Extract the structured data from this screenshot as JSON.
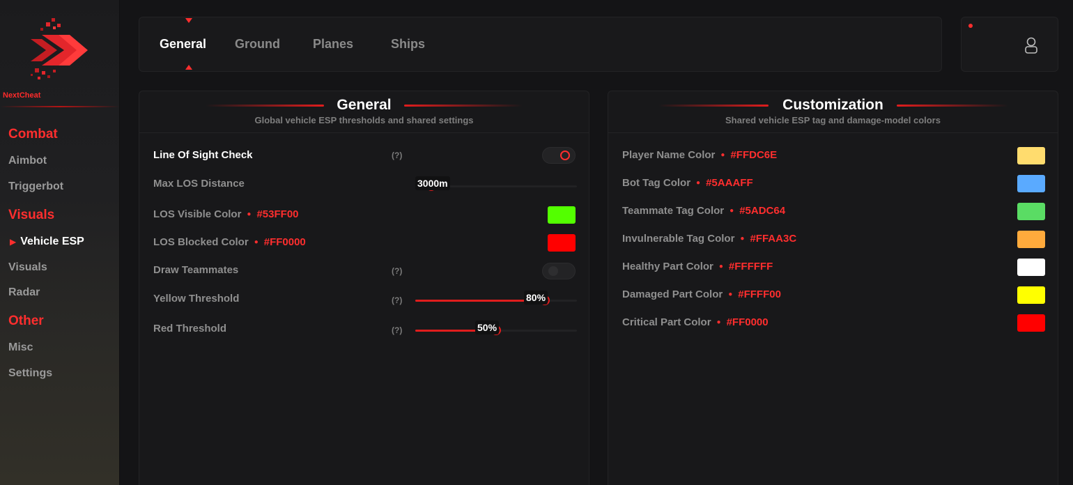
{
  "app": {
    "brand": "NextCheat"
  },
  "sidebar": {
    "sections": [
      {
        "label": "Combat",
        "items": [
          "Aimbot",
          "Triggerbot"
        ]
      },
      {
        "label": "Visuals",
        "items": [
          "Vehicle ESP",
          "Visuals",
          "Radar"
        ]
      },
      {
        "label": "Other",
        "items": [
          "Misc",
          "Settings"
        ]
      }
    ],
    "active_item": "Vehicle ESP"
  },
  "tabs": [
    {
      "label": "General",
      "active": true
    },
    {
      "label": "Ground",
      "active": false
    },
    {
      "label": "Planes",
      "active": false
    },
    {
      "label": "Ships",
      "active": false
    }
  ],
  "general_panel": {
    "title": "General",
    "subtitle": "Global vehicle ESP thresholds and shared settings",
    "line_of_sight": {
      "label": "Line Of Sight Check",
      "help": "(?)",
      "enabled": true
    },
    "max_los_distance": {
      "label": "Max LOS Distance",
      "value": "3000m",
      "fill": 0.1
    },
    "los_visible_color": {
      "label": "LOS Visible Color",
      "hex": "#53FF00",
      "color": "#53ff00"
    },
    "los_blocked_color": {
      "label": "LOS Blocked Color",
      "hex": "#FF0000",
      "color": "#ff0000"
    },
    "draw_teammates": {
      "label": "Draw Teammates",
      "help": "(?)",
      "enabled": false
    },
    "yellow_threshold": {
      "label": "Yellow Threshold",
      "help": "(?)",
      "value": "80%",
      "fill": 0.8
    },
    "red_threshold": {
      "label": "Red Threshold",
      "help": "(?)",
      "value": "50%",
      "fill": 0.5
    }
  },
  "customization_panel": {
    "title": "Customization",
    "subtitle": "Shared vehicle ESP tag and damage-model colors",
    "rows": [
      {
        "label": "Player Name Color",
        "hex": "#FFDC6E",
        "color": "#ffdc6e"
      },
      {
        "label": "Bot Tag Color",
        "hex": "#5AAAFF",
        "color": "#5aaaff"
      },
      {
        "label": "Teammate Tag Color",
        "hex": "#5ADC64",
        "color": "#5adc64"
      },
      {
        "label": "Invulnerable Tag Color",
        "hex": "#FFAA3C",
        "color": "#ffaa3c"
      },
      {
        "label": "Healthy Part Color",
        "hex": "#FFFFFF",
        "color": "#ffffff"
      },
      {
        "label": "Damaged Part Color",
        "hex": "#FFFF00",
        "color": "#ffff00"
      },
      {
        "label": "Critical Part Color",
        "hex": "#FF0000",
        "color": "#ff0000"
      }
    ]
  },
  "colors": {
    "accent": "#ff2e2e",
    "background": "#141416",
    "panel": "#18181a"
  }
}
